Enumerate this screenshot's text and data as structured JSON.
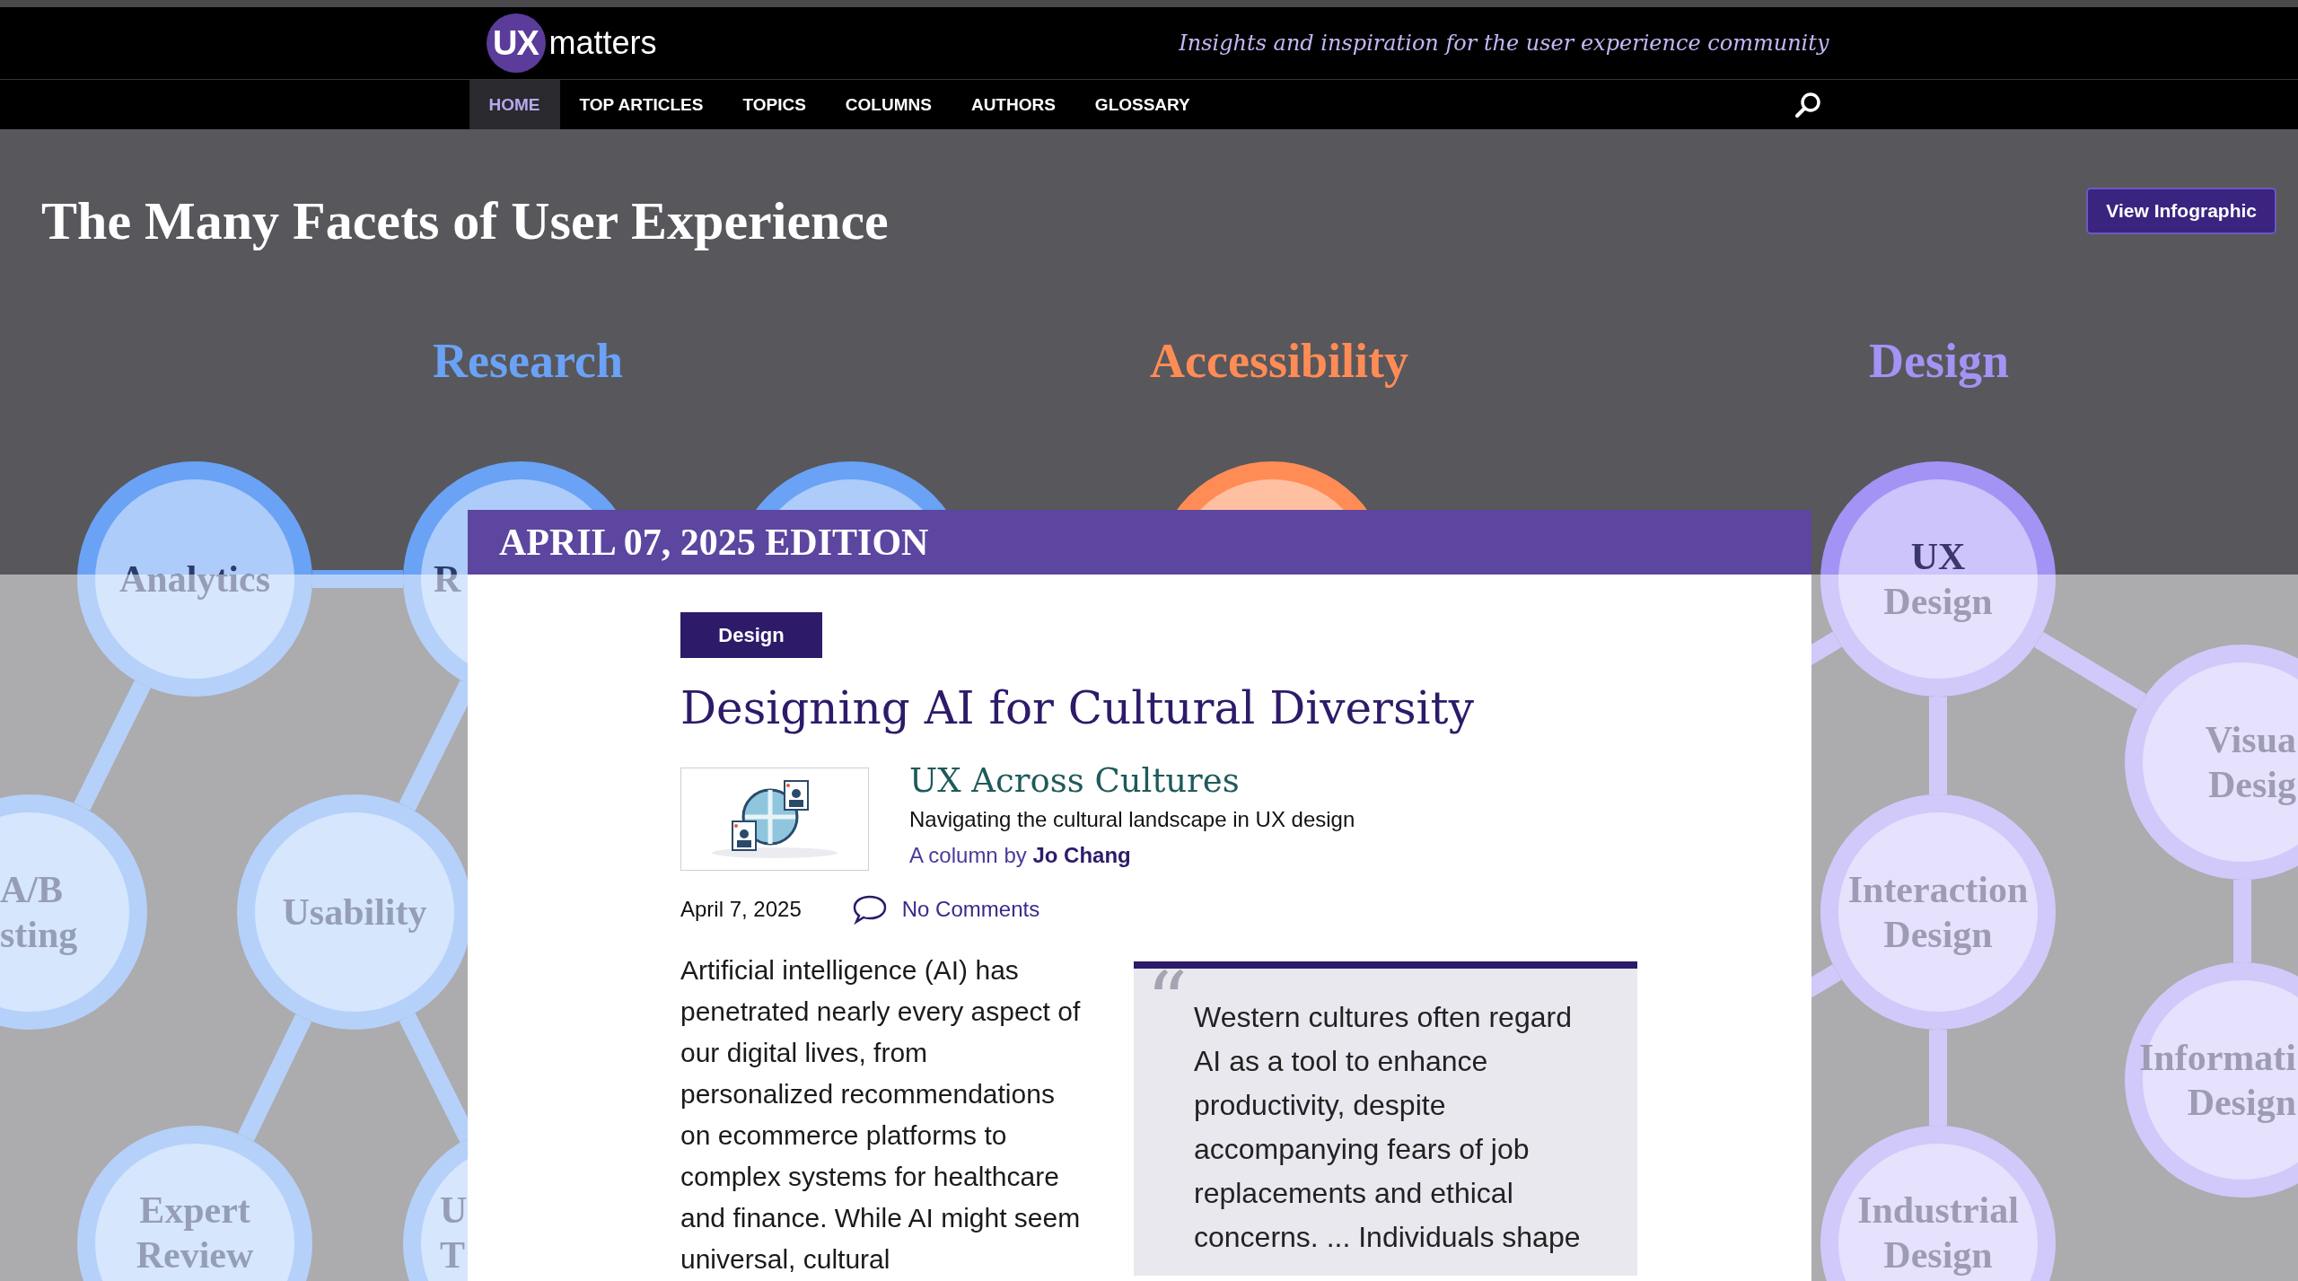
{
  "site": {
    "logo_mark": "UX",
    "logo_text": "matters",
    "tagline": "Insights and inspiration for the user experience community"
  },
  "nav": [
    {
      "label": "HOME",
      "selected": true
    },
    {
      "label": "TOP ARTICLES",
      "selected": false
    },
    {
      "label": "TOPICS",
      "selected": false
    },
    {
      "label": "COLUMNS",
      "selected": false
    },
    {
      "label": "AUTHORS",
      "selected": false
    },
    {
      "label": "GLOSSARY",
      "selected": false
    }
  ],
  "hero": {
    "title": "The Many Facets of User Experience",
    "button": "View Infographic"
  },
  "infographic": {
    "categories": [
      {
        "name": "Research",
        "color": "#6aa2f5",
        "nodes": [
          {
            "lines": [
              "Analytics"
            ]
          },
          {
            "lines": [
              "R"
            ]
          },
          {
            "lines": [
              "A/B",
              "sting"
            ]
          },
          {
            "lines": [
              "Usability"
            ]
          },
          {
            "lines": [
              "Expert",
              "Review"
            ]
          },
          {
            "lines": [
              "U",
              "T"
            ]
          }
        ]
      },
      {
        "name": "Accessibility",
        "color": "#ff8c55"
      },
      {
        "name": "Design",
        "color": "#a393f5",
        "nodes": [
          {
            "lines": [
              "UX",
              "Design"
            ]
          },
          {
            "lines": [
              "Visua",
              "Desig"
            ]
          },
          {
            "lines": [
              "Interaction",
              "Design"
            ]
          },
          {
            "lines": [
              "Informati",
              "Design"
            ]
          },
          {
            "lines": [
              "Industrial",
              "Design"
            ]
          }
        ]
      }
    ]
  },
  "edition": {
    "title": "APRIL 07, 2025 EDITION",
    "tag": "Design",
    "headline": "Designing AI for Cultural Diversity",
    "column_title": "UX Across Cultures",
    "column_subtitle": "Navigating the cultural landscape in UX design",
    "byline": "A column by **Jo Chang**",
    "date": "April 7, 2025",
    "comments": "No Comments",
    "body": "Artificial intelligence (AI) has penetrated nearly every aspect of our digital lives, from personalized recommendations on ecommerce platforms to complex systems for healthcare and finance. While AI might seem universal, cultural",
    "quote_mark": "“",
    "quote": "Western cultures often regard AI as a tool to enhance productivity, despite accompanying fears of job replacements and ethical concerns. ... Individuals shape"
  }
}
